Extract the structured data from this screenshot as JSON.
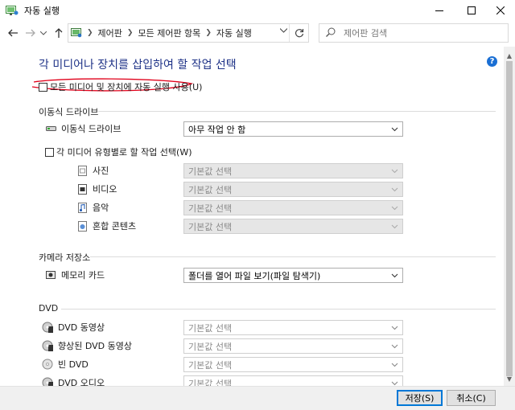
{
  "window": {
    "title": "자동 실행"
  },
  "nav": {
    "breadcrumbs": [
      "제어판",
      "모든 제어판 항목",
      "자동 실행"
    ],
    "search_placeholder": "제어판 검색"
  },
  "main": {
    "heading": "각 미디어나 장치를 삽입하여 할 작업 선택",
    "use_autoplay_label": "모든 미디어 및 장치에 자동 실행 사용(U)",
    "use_autoplay_checked": false,
    "sections": {
      "removable": {
        "title": "이동식 드라이브",
        "drive_label": "이동식 드라이브",
        "drive_value": "아무 작업 안 함",
        "per_type_label": "각 미디어 유형별로 할 작업 선택(W)",
        "per_type_checked": false,
        "items": [
          {
            "label": "사진",
            "value": "기본값 선택"
          },
          {
            "label": "비디오",
            "value": "기본값 선택"
          },
          {
            "label": "음악",
            "value": "기본값 선택"
          },
          {
            "label": "혼합 콘텐츠",
            "value": "기본값 선택"
          }
        ]
      },
      "camera": {
        "title": "카메라 저장소",
        "items": [
          {
            "label": "메모리 카드",
            "value": "폴더를 열어 파일 보기(파일 탐색기)"
          }
        ]
      },
      "dvd": {
        "title": "DVD",
        "items": [
          {
            "label": "DVD 동영상",
            "value": "기본값 선택"
          },
          {
            "label": "향상된 DVD 동영상",
            "value": "기본값 선택"
          },
          {
            "label": "빈 DVD",
            "value": "기본값 선택"
          },
          {
            "label": "DVD 오디오",
            "value": "기본값 선택"
          }
        ]
      }
    }
  },
  "footer": {
    "save_label": "저장(S)",
    "cancel_label": "취소(C)"
  },
  "colors": {
    "heading": "#1e3287",
    "accent": "#0078d7",
    "annotation": "#e0001a"
  },
  "icons": [
    "autoplay-app-icon",
    "back-arrow-icon",
    "forward-arrow-icon",
    "dropdown-icon",
    "up-arrow-icon",
    "control-panel-icon",
    "refresh-icon",
    "search-icon",
    "help-icon",
    "drive-icon",
    "photo-icon",
    "video-icon",
    "music-icon",
    "mixed-content-icon",
    "memory-card-icon",
    "dvd-icon"
  ]
}
